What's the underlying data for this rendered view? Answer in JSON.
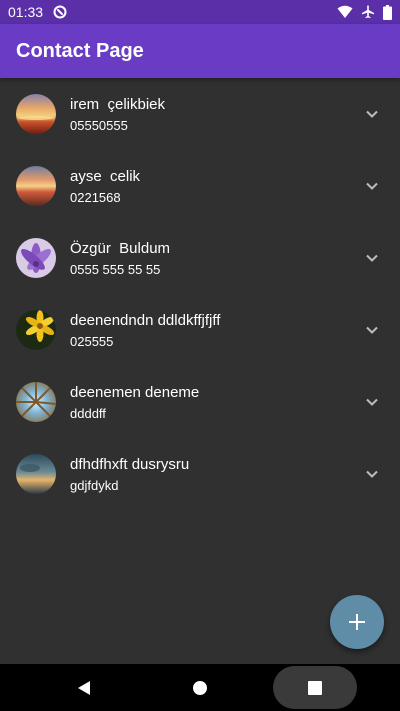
{
  "status_bar": {
    "time": "01:33",
    "icons": [
      "app-notification-icon",
      "wifi-icon",
      "airplane-mode-icon",
      "battery-icon"
    ]
  },
  "app_bar": {
    "title": "Contact Page"
  },
  "contacts": [
    {
      "name": "irem  çelikbiek",
      "phone": "05550555",
      "avatar": "sunset-field-photo"
    },
    {
      "name": "ayse  celik",
      "phone": "0221568",
      "avatar": "sunset-sky-photo"
    },
    {
      "name": "Özgür  Buldum",
      "phone": "0555 555 55 55",
      "avatar": "purple-flower-photo"
    },
    {
      "name": "deenendndn ddldkffjfjff",
      "phone": "025555",
      "avatar": "yellow-flower-photo"
    },
    {
      "name": "deenemen deneme",
      "phone": "ddddff",
      "avatar": "tree-canopy-photo"
    },
    {
      "name": "dfhdfhxft dusrysru",
      "phone": "gdjfdykd",
      "avatar": "cloudy-sunset-photo"
    }
  ],
  "fab": {
    "icon": "plus-icon"
  },
  "nav_bar": {
    "icons": [
      "back-icon",
      "home-icon",
      "recents-icon"
    ]
  },
  "colors": {
    "app_bar": "#6a3cc5",
    "status_bar": "#5a2fa8",
    "background": "#303030",
    "fab": "#5f8ca6",
    "text": "#ffffff",
    "chevron": "#bdbdbd"
  }
}
